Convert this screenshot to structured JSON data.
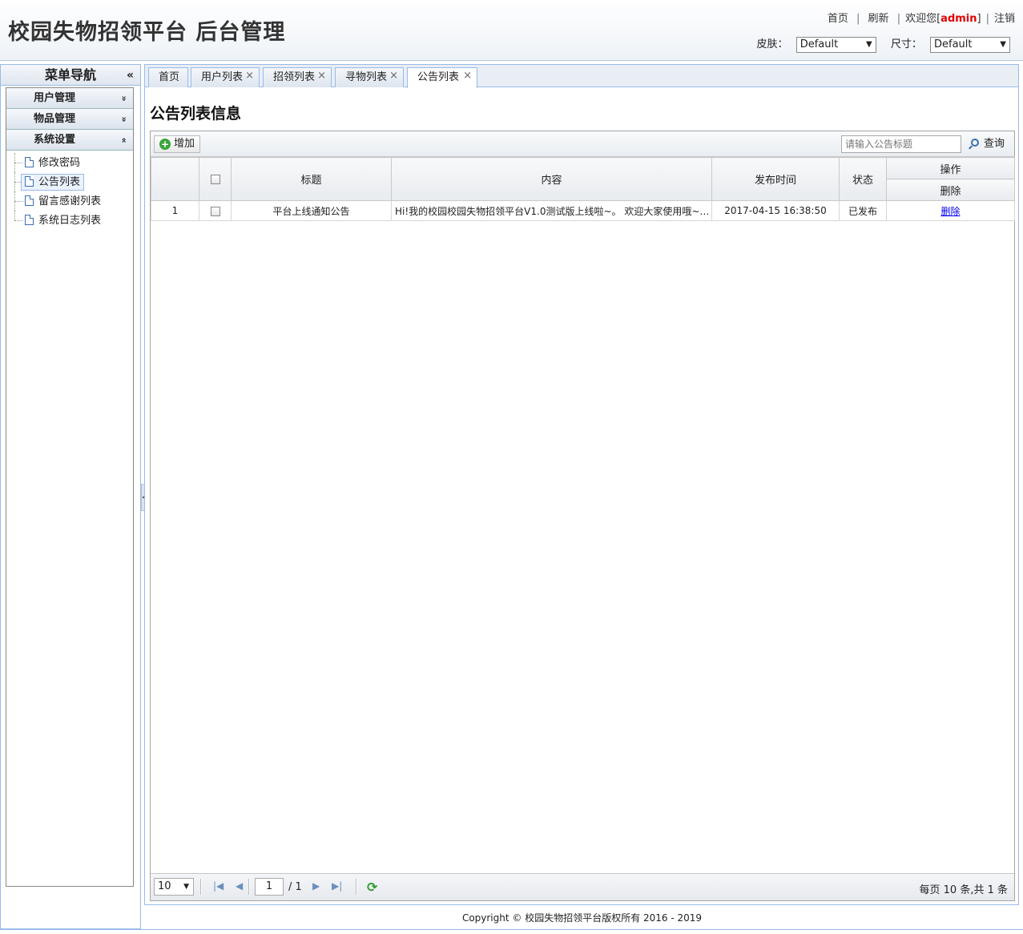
{
  "header": {
    "title": "校园失物招领平台 后台管理",
    "links": {
      "home": "首页",
      "refresh": "刷新",
      "welcome_prefix": "欢迎您[",
      "user": "admin",
      "welcome_suffix": "]",
      "logout": "注销",
      "sep": "|"
    },
    "skin_label": "皮肤：",
    "skin_value": "Default",
    "size_label": "尺寸：",
    "size_value": "Default"
  },
  "sidebar": {
    "title": "菜单导航",
    "collapse_glyph": "«",
    "groups": [
      {
        "label": "用户管理",
        "chevron": "»"
      },
      {
        "label": "物品管理",
        "chevron": "»"
      },
      {
        "label": "系统设置",
        "chevron": "«"
      }
    ],
    "items": [
      {
        "label": "修改密码",
        "selected": false
      },
      {
        "label": "公告列表",
        "selected": true
      },
      {
        "label": "留言感谢列表",
        "selected": false
      },
      {
        "label": "系统日志列表",
        "selected": false
      }
    ]
  },
  "tabs": [
    {
      "label": "首页",
      "closable": false
    },
    {
      "label": "用户列表",
      "closable": true
    },
    {
      "label": "招领列表",
      "closable": true
    },
    {
      "label": "寻物列表",
      "closable": true
    },
    {
      "label": "公告列表",
      "closable": true,
      "active": true
    }
  ],
  "content": {
    "title": "公告列表信息",
    "add_label": "增加",
    "search_placeholder": "请输入公告标题",
    "search_label": "查询"
  },
  "table": {
    "columns": {
      "title": "标题",
      "content": "内容",
      "time": "发布时间",
      "status": "状态",
      "ops": "操作",
      "ops_sub": "删除"
    },
    "rows": [
      {
        "index": "1",
        "title": "平台上线通知公告",
        "content": "Hi!我的校园校园失物招领平台V1.0测试版上线啦~。 欢迎大家使用哦~~...",
        "time": "2017-04-15 16:38:50",
        "status": "已发布",
        "action": "删除"
      }
    ]
  },
  "pager": {
    "page_size": "10",
    "page": "1",
    "total_pages": "/ 1",
    "info": "每页 10 条,共 1 条"
  },
  "footer": {
    "copyright": "Copyright © 校园失物招领平台版权所有  2016 - 2019"
  },
  "colors": {
    "accent_border": "#99bbe8",
    "admin_red": "#e00000",
    "link_blue": "#0000ee"
  }
}
